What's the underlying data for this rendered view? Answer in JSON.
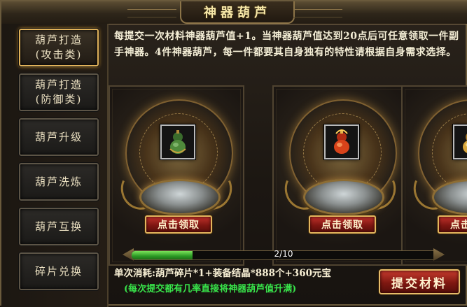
{
  "window": {
    "title": "神器葫芦"
  },
  "sidebar": {
    "items": [
      {
        "label": "葫芦打造\n(攻击类)",
        "active": true
      },
      {
        "label": "葫芦打造\n(防御类)",
        "active": false
      },
      {
        "label": "葫芦升级",
        "active": false
      },
      {
        "label": "葫芦洗炼",
        "active": false
      },
      {
        "label": "葫芦互换",
        "active": false
      },
      {
        "label": "碎片兑换",
        "active": false
      }
    ]
  },
  "main": {
    "description": "每提交一次材料神器葫芦值+1。当神器葫芦值达到20点后可任意领取一件副手神器。4件神器葫芦，每一件都要其自身独有的特性请根据自身需求选择。",
    "cards": [
      {
        "item_icon": "green-gourd-icon",
        "claim_label": "点击领取"
      },
      {
        "item_icon": "red-gourd-icon",
        "claim_label": "点击领取"
      },
      {
        "item_icon": "gold-gourd-icon",
        "claim_label": "点击领取"
      }
    ],
    "progress": {
      "label": "2/10",
      "fraction": 0.2
    },
    "cost_text": "单次消耗:葫芦碎片*1+装备结晶*888个+360元宝",
    "note_text": "(每次提交都有几率直接将神器葫芦值升满)",
    "submit_label": "提交材料"
  },
  "colors": {
    "accent_gold": "#e0b25a",
    "progress_green": "#2b9a25",
    "note_green": "#38e34a",
    "button_red": "#7f1811"
  }
}
